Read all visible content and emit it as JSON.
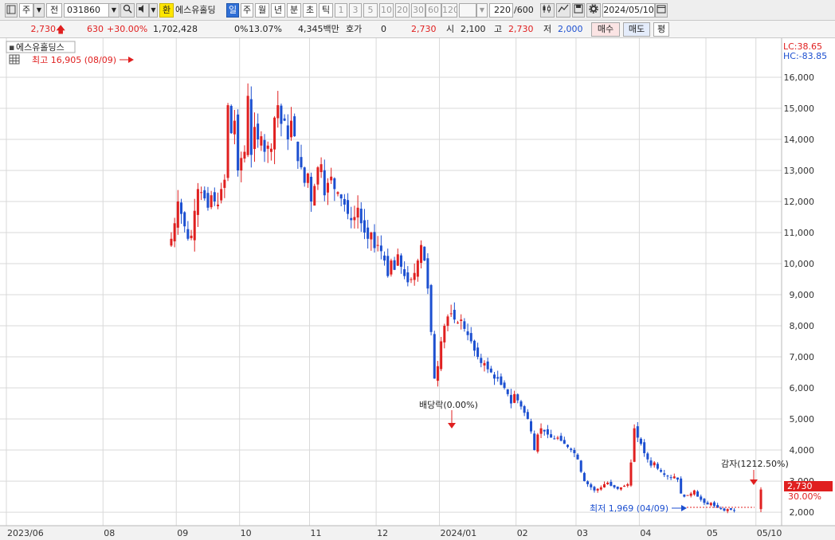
{
  "toolbar": {
    "type_label": "주",
    "all_label": "전",
    "code": "031860",
    "exchange_label": "환",
    "stock_name": "에스유홀딩",
    "periods": [
      "일",
      "주",
      "월",
      "년",
      "분",
      "초",
      "틱"
    ],
    "active_period": "일",
    "intervals": [
      "1",
      "3",
      "5",
      "10",
      "20",
      "30",
      "60",
      "120"
    ],
    "count_value": "220",
    "count_max": "/600",
    "date": "2024/05/10"
  },
  "quote": {
    "price": "2,730",
    "change": "630",
    "change_pct": "+30.00%",
    "volume": "1,702,428",
    "vol_ratio_label": "0%",
    "turnover": "13.07%",
    "amount": "4,345백만",
    "hoga_label": "호가",
    "hoga_value": "0",
    "hoga_price": "2,730",
    "open_label": "시",
    "open": "2,100",
    "high_label": "고",
    "high": "2,730",
    "low_label": "저",
    "low": "2,000",
    "buy_label": "매수",
    "sell_label": "매도",
    "flat_label": "평"
  },
  "chart_title": "에스유홀딩스",
  "lc_label": "LC:38.65",
  "hc_label": "HC:-83.85",
  "price_tag": "2,730",
  "pct_tag": "30.00%",
  "annotations": {
    "max_label": "최고 16,905 (08/09)",
    "min_label": "최저 1,969 (04/09)",
    "dividend_label": "배당락(0.00%)",
    "capital_label": "감자(1212.50%)"
  },
  "colors": {
    "up": "#e02020",
    "down": "#1c4fd0",
    "grid": "#d9d9d9"
  },
  "chart_data": {
    "type": "candlestick",
    "title": "에스유홀딩스",
    "y_ticks": [
      2000,
      3000,
      4000,
      5000,
      6000,
      7000,
      8000,
      9000,
      10000,
      11000,
      12000,
      13000,
      14000,
      15000,
      16000
    ],
    "y_tick_labels": [
      "2,000",
      "3,000",
      "4,000",
      "5,000",
      "6,000",
      "7,000",
      "8,000",
      "9,000",
      "10,000",
      "11,000",
      "12,000",
      "13,000",
      "14,000",
      "15,000",
      "16,000"
    ],
    "ylim": [
      1720,
      17050
    ],
    "x_labels": [
      "2023/06",
      "08",
      "09",
      "10",
      "11",
      "12",
      "2024/01",
      "02",
      "03",
      "04",
      "05",
      "05/10"
    ],
    "x_label_session_index": [
      0,
      29,
      51,
      70,
      91,
      111,
      130,
      153,
      171,
      190,
      210,
      225
    ],
    "total_sessions": 232,
    "grid": true,
    "closes": [
      10800,
      11300,
      12000,
      11600,
      11200,
      10800,
      10900,
      11700,
      12400,
      12300,
      12100,
      11800,
      12200,
      12000,
      11900,
      12400,
      12700,
      15100,
      14200,
      14600,
      13000,
      13400,
      13600,
      15400,
      13500,
      14400,
      14000,
      14100,
      13600,
      13800,
      13700,
      14700,
      15100,
      14500,
      14600,
      14000,
      14600,
      14100,
      13300,
      13100,
      12600,
      12900,
      12000,
      12500,
      13100,
      13200,
      12200,
      12600,
      12800,
      12400,
      12300,
      12100,
      11900,
      11600,
      11400,
      11500,
      11800,
      11300,
      11000,
      10800,
      11000,
      10500,
      10600,
      10400,
      10100,
      9600,
      10100,
      9800,
      10300,
      9900,
      9600,
      9400,
      9500,
      9700,
      10100,
      10600,
      10100,
      9200,
      7800,
      6300,
      6700,
      7500,
      8000,
      8300,
      8400,
      8200,
      8100,
      8200,
      7900,
      7700,
      7500,
      7200,
      7000,
      6800,
      6800,
      6600,
      6500,
      6300,
      6300,
      6100,
      6000,
      5800,
      5500,
      5800,
      5600,
      5400,
      5200,
      5000,
      4600,
      4000,
      4500,
      4700,
      4600,
      4500,
      4400,
      4350,
      4400,
      4300,
      4200,
      4100,
      4000,
      3900,
      3700,
      3300,
      3000,
      2900,
      2800,
      2700,
      2750,
      2800,
      2900,
      2950,
      2850,
      2800,
      2750,
      2800,
      2850,
      2900,
      3600,
      4700,
      4400,
      4200,
      3900,
      3700,
      3500,
      3600,
      3400,
      3300,
      3200,
      3150,
      3100,
      3150,
      3050,
      2600,
      2500,
      2550,
      2600,
      2700,
      2500,
      2400,
      2300,
      2250,
      2300,
      2200,
      2150,
      2100,
      2050,
      2100,
      2080,
      2060,
      2730
    ]
  }
}
